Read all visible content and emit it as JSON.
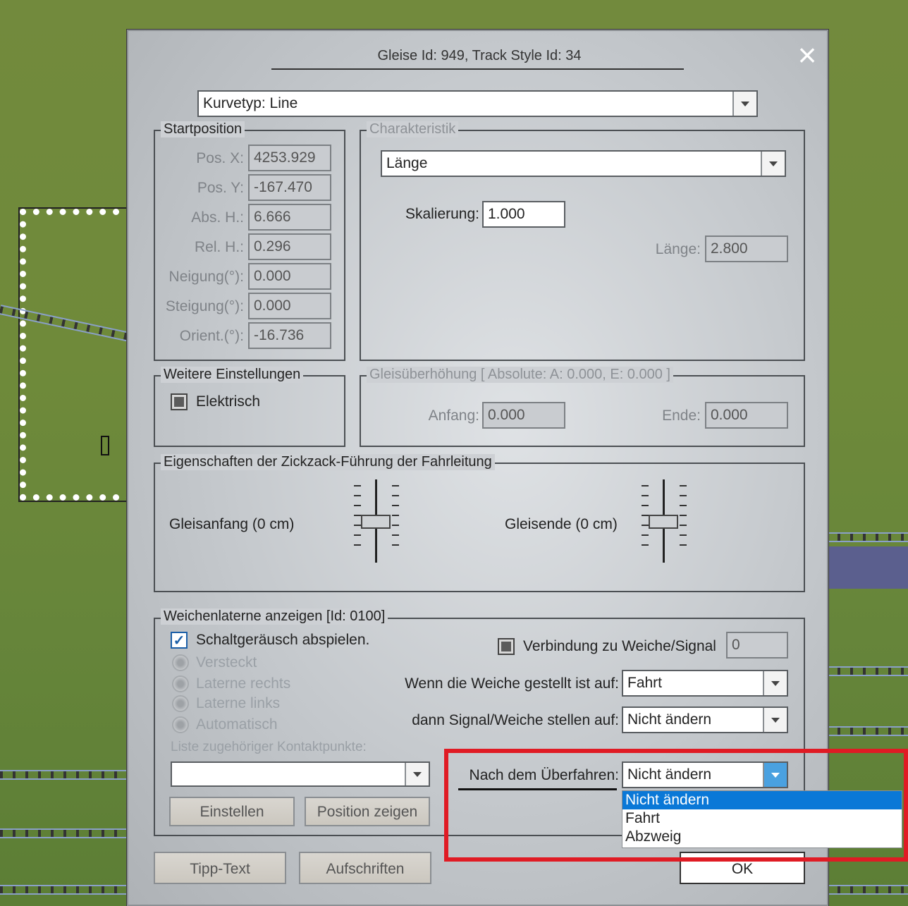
{
  "dialog": {
    "title": "Gleise Id: 949, Track Style Id: 34",
    "close_icon": "×",
    "curve_type": "Kurvetyp: Line"
  },
  "start_position": {
    "legend": "Startposition",
    "rows": [
      {
        "label": "Pos. X:",
        "value": "4253.929"
      },
      {
        "label": "Pos. Y:",
        "value": "-167.470"
      },
      {
        "label": "Abs. H.:",
        "value": "6.666"
      },
      {
        "label": "Rel. H.:",
        "value": "0.296"
      },
      {
        "label": "Neigung(°):",
        "value": "0.000"
      },
      {
        "label": "Steigung(°):",
        "value": "0.000"
      },
      {
        "label": "Orient.(°):",
        "value": "-16.736"
      }
    ]
  },
  "characteristic": {
    "legend": "Charakteristik",
    "type_value": "Länge",
    "scale_label": "Skalierung:",
    "scale_value": "1.000",
    "length_label": "Länge:",
    "length_value": "2.800"
  },
  "further_settings": {
    "legend": "Weitere Einstellungen",
    "electric_label": "Elektrisch"
  },
  "superelevation": {
    "legend": "Gleisüberhöhung [ Absolute: A: 0.000, E: 0.000 ]",
    "start_label": "Anfang:",
    "start_value": "0.000",
    "end_label": "Ende:",
    "end_value": "0.000"
  },
  "zigzag": {
    "legend": "Eigenschaften der Zickzack-Führung der Fahrleitung",
    "start_label": "Gleisanfang (0 cm)",
    "end_label": "Gleisende (0 cm)"
  },
  "lantern": {
    "legend": "Weichenlaterne anzeigen [Id: 0100]",
    "sound_label": "Schaltgeräusch abspielen.",
    "radios": [
      "Versteckt",
      "Laterne rechts",
      "Laterne links",
      "Automatisch"
    ],
    "connection_label": "Verbindung zu Weiche/Signal",
    "connection_value": "0",
    "when_label": "Wenn die Weiche gestellt ist auf:",
    "when_value": "Fahrt",
    "then_label": "dann Signal/Weiche stellen auf:",
    "then_value": "Nicht ändern",
    "contacts_label": "Liste zugehöriger Kontaktpunkte:",
    "contacts_value": "",
    "after_label": "Nach dem Überfahren:",
    "after_value": "Nicht ändern",
    "after_options": [
      "Nicht ändern",
      "Fahrt",
      "Abzweig"
    ],
    "set_button": "Einstellen",
    "show_position_button": "Position zeigen"
  },
  "footer": {
    "tooltip_button": "Tipp-Text",
    "labels_button": "Aufschriften",
    "ok_button": "OK"
  },
  "colors": {
    "highlight_red": "#e01b24",
    "selection_blue": "#0a78d7"
  }
}
